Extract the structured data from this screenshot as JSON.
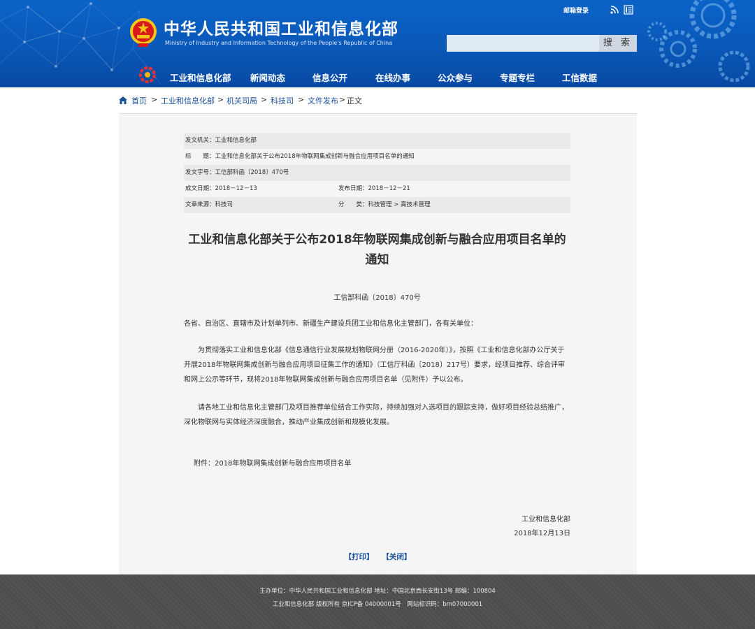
{
  "header": {
    "title": "中华人民共和国工业和信息化部",
    "subtitle": "Ministry of Industry and Information Technology of the People's Republic of China",
    "mail_login": "邮箱登录",
    "search": {
      "placeholder": "",
      "button_label": "搜 索"
    },
    "nav": [
      "工业和信息化部",
      "新闻动态",
      "信息公开",
      "在线办事",
      "公众参与",
      "专题专栏",
      "工信数据"
    ],
    "colors": {
      "primary": "#0a58b8",
      "dark": "#0749a3"
    }
  },
  "breadcrumb": {
    "items": [
      "首页",
      "工业和信息化部",
      "机关司局",
      "科技司",
      "文件发布",
      "正文"
    ],
    "separator": ">"
  },
  "meta": {
    "issuer": "发文机关：工业和信息化部",
    "title": "标　　题：工业和信息化部关于公布2018年物联网集成创新与融合应用项目名单的通知",
    "doc_number": "发文字号：工信部科函〔2018〕470号",
    "created": "成文日期：2018－12－13",
    "published": "发布日期：2018－12－21",
    "source": "文章来源：科技司",
    "category": "分　　类：科技管理 > 高技术管理"
  },
  "article": {
    "title": "工业和信息化部关于公布2018年物联网集成创新与融合应用项目名单的通知",
    "doc_no": "工信部科函〔2018〕470号",
    "salutation": "各省、自治区、直辖市及计划单列市、新疆生产建设兵团工业和信息化主管部门，各有关单位：",
    "paragraph1": "为贯彻落实工业和信息化部《信息通信行业发展规划物联网分册（2016-2020年）》，按照《工业和信息化部办公厅关于开展2018年物联网集成创新与融合应用项目征集工作的通知》（工信厅科函〔2018〕217号）要求，经项目推荐、综合评审和网上公示等环节，现将2018年物联网集成创新与融合应用项目名单（见附件）予以公布。",
    "paragraph2": "请各地工业和信息化主管部门及项目推荐单位结合工作实际，持续加强对入选项目的跟踪支持，做好项目经验总结推广，深化物联网与实体经济深度融合，推动产业集成创新和规模化发展。",
    "attachment": "附件：2018年物联网集成创新与融合应用项目名单",
    "sign_org": "工业和信息化部",
    "sign_date": "2018年12月13日",
    "print_label": "【打印】",
    "close_label": "【关闭】"
  },
  "footer": {
    "line1": "主办单位：中华人民共和国工业和信息化部 地址：中国北京西长安街13号 邮编：100804",
    "line2": "工业和信息化部 版权所有 京ICP备 04000001号　网站标识码：bm07000001"
  }
}
